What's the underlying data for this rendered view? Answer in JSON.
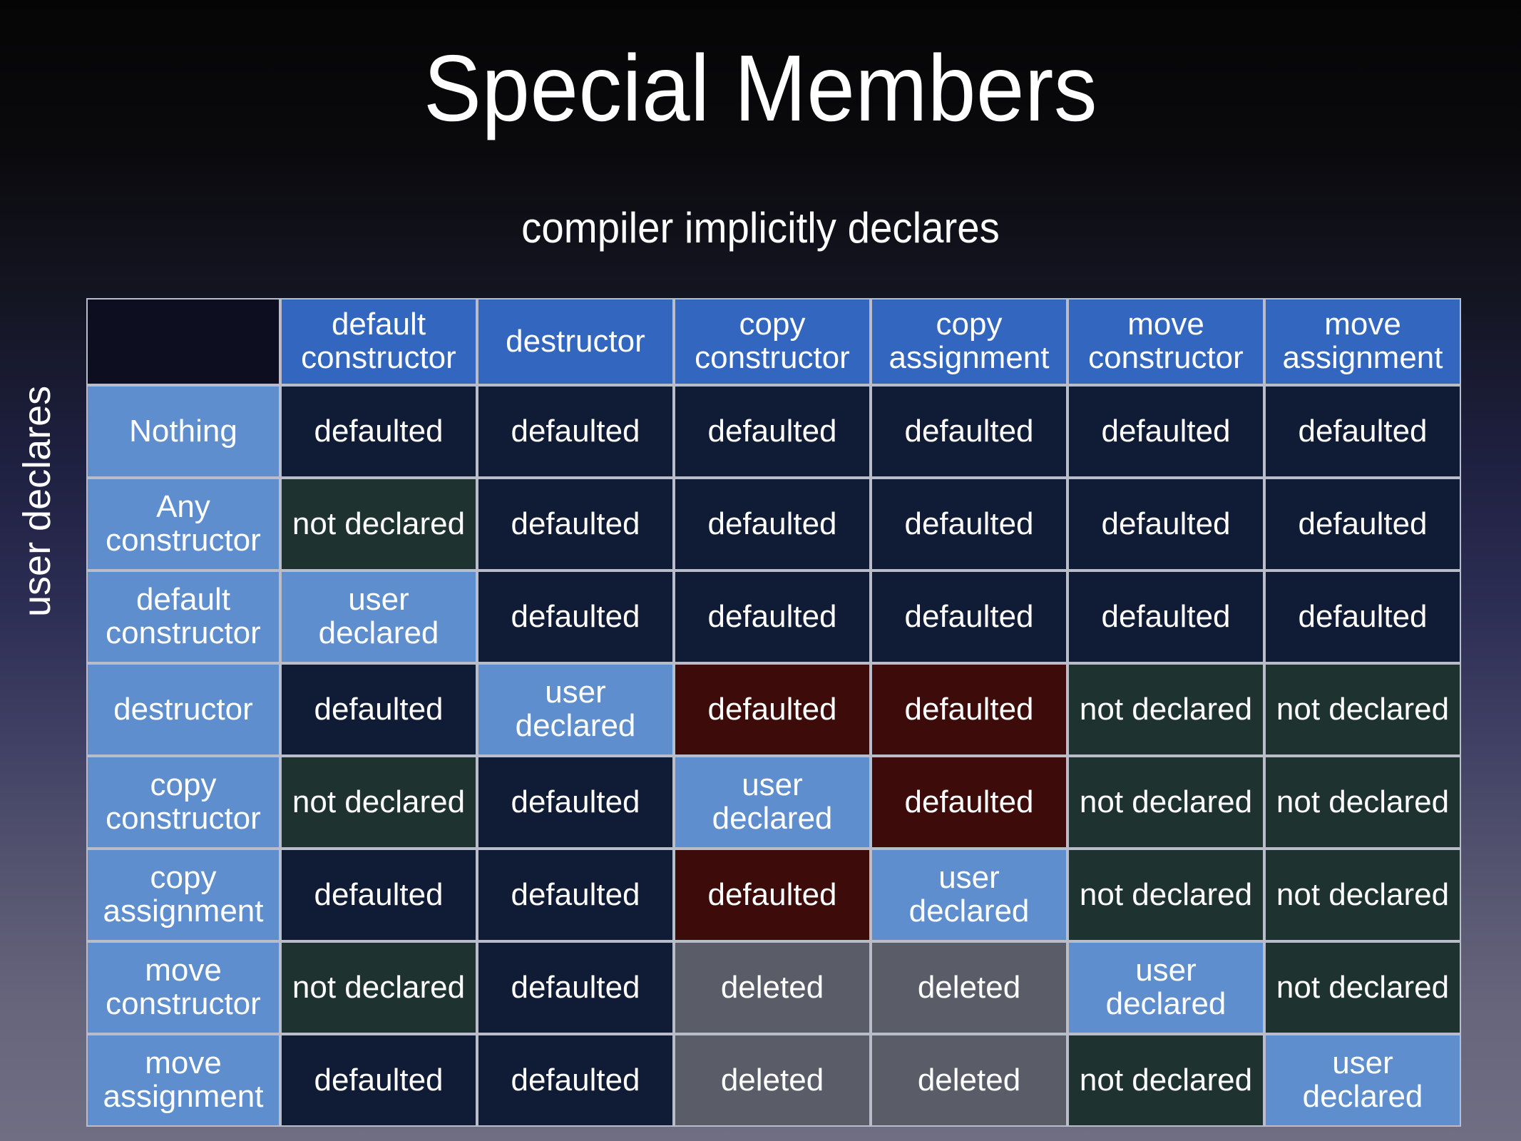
{
  "slide": {
    "title": "Special Members",
    "subtitle": "compiler implicitly declares",
    "row_axis_label": "user declares"
  },
  "colors": {
    "column_header": "#3366be",
    "row_header": "#5e8ece",
    "defaulted": "#101b35",
    "not_declared": "#1e332f",
    "user_declared": "#5e8ece",
    "highlight_red": "#3d0c0a",
    "deleted": "#5a5d68",
    "corner": "#0d0f20",
    "grid_line": "#b9bcc9",
    "text": "#ffffff"
  },
  "table": {
    "corner_label": "",
    "column_headers": [
      "default constructor",
      "destructor",
      "copy constructor",
      "copy assignment",
      "move constructor",
      "move assignment"
    ],
    "rows": [
      {
        "header": "Nothing",
        "cells": [
          {
            "text": "defaulted",
            "style": "defaulted"
          },
          {
            "text": "defaulted",
            "style": "defaulted"
          },
          {
            "text": "defaulted",
            "style": "defaulted"
          },
          {
            "text": "defaulted",
            "style": "defaulted"
          },
          {
            "text": "defaulted",
            "style": "defaulted"
          },
          {
            "text": "defaulted",
            "style": "defaulted"
          }
        ]
      },
      {
        "header": "Any constructor",
        "cells": [
          {
            "text": "not declared",
            "style": "not_declared"
          },
          {
            "text": "defaulted",
            "style": "defaulted"
          },
          {
            "text": "defaulted",
            "style": "defaulted"
          },
          {
            "text": "defaulted",
            "style": "defaulted"
          },
          {
            "text": "defaulted",
            "style": "defaulted"
          },
          {
            "text": "defaulted",
            "style": "defaulted"
          }
        ]
      },
      {
        "header": "default constructor",
        "cells": [
          {
            "text": "user declared",
            "style": "user_declared"
          },
          {
            "text": "defaulted",
            "style": "defaulted"
          },
          {
            "text": "defaulted",
            "style": "defaulted"
          },
          {
            "text": "defaulted",
            "style": "defaulted"
          },
          {
            "text": "defaulted",
            "style": "defaulted"
          },
          {
            "text": "defaulted",
            "style": "defaulted"
          }
        ]
      },
      {
        "header": "destructor",
        "cells": [
          {
            "text": "defaulted",
            "style": "defaulted"
          },
          {
            "text": "user declared",
            "style": "user_declared"
          },
          {
            "text": "defaulted",
            "style": "highlight_red"
          },
          {
            "text": "defaulted",
            "style": "highlight_red"
          },
          {
            "text": "not declared",
            "style": "not_declared"
          },
          {
            "text": "not declared",
            "style": "not_declared"
          }
        ]
      },
      {
        "header": "copy constructor",
        "cells": [
          {
            "text": "not declared",
            "style": "not_declared"
          },
          {
            "text": "defaulted",
            "style": "defaulted"
          },
          {
            "text": "user declared",
            "style": "user_declared"
          },
          {
            "text": "defaulted",
            "style": "highlight_red"
          },
          {
            "text": "not declared",
            "style": "not_declared"
          },
          {
            "text": "not declared",
            "style": "not_declared"
          }
        ]
      },
      {
        "header": "copy assignment",
        "cells": [
          {
            "text": "defaulted",
            "style": "defaulted"
          },
          {
            "text": "defaulted",
            "style": "defaulted"
          },
          {
            "text": "defaulted",
            "style": "highlight_red"
          },
          {
            "text": "user declared",
            "style": "user_declared"
          },
          {
            "text": "not declared",
            "style": "not_declared"
          },
          {
            "text": "not declared",
            "style": "not_declared"
          }
        ]
      },
      {
        "header": "move constructor",
        "cells": [
          {
            "text": "not declared",
            "style": "not_declared"
          },
          {
            "text": "defaulted",
            "style": "defaulted"
          },
          {
            "text": "deleted",
            "style": "deleted"
          },
          {
            "text": "deleted",
            "style": "deleted"
          },
          {
            "text": "user declared",
            "style": "user_declared"
          },
          {
            "text": "not declared",
            "style": "not_declared"
          }
        ]
      },
      {
        "header": "move assignment",
        "cells": [
          {
            "text": "defaulted",
            "style": "defaulted"
          },
          {
            "text": "defaulted",
            "style": "defaulted"
          },
          {
            "text": "deleted",
            "style": "deleted"
          },
          {
            "text": "deleted",
            "style": "deleted"
          },
          {
            "text": "not declared",
            "style": "not_declared"
          },
          {
            "text": "user declared",
            "style": "user_declared"
          }
        ]
      }
    ]
  }
}
